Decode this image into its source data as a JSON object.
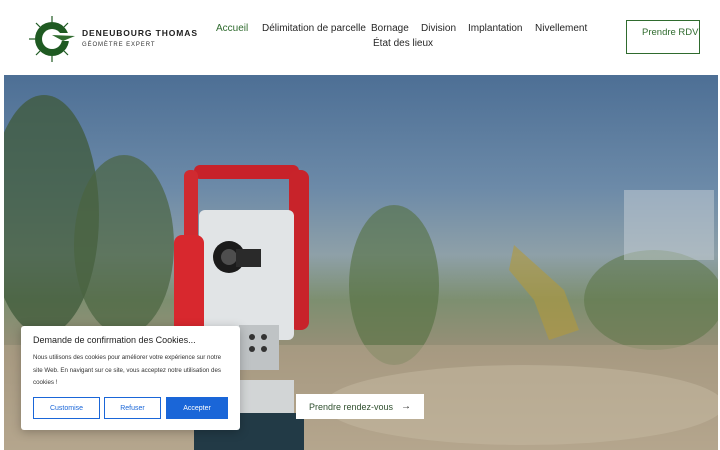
{
  "brand": {
    "name": "DENEUBOURG THOMAS",
    "subtitle": "GÉOMÈTRE EXPERT",
    "accent_color": "#2f6b2e"
  },
  "nav": {
    "items": [
      {
        "label": "Accueil",
        "active": true
      },
      {
        "label": "Délimitation de parcelle",
        "active": false
      },
      {
        "label": "Bornage",
        "active": false
      },
      {
        "label": "Division",
        "active": false
      },
      {
        "label": "Implantation",
        "active": false
      },
      {
        "label": "Nivellement",
        "active": false
      },
      {
        "label": "État des lieux",
        "active": false
      }
    ],
    "rdv_label": "Prendre RDV"
  },
  "hero": {
    "cta_label": "Prendre rendez-vous",
    "cta_icon": "arrow-right-icon"
  },
  "cookie": {
    "title": "Demande de confirmation des Cookies...",
    "text": "Nous utilisons des cookies pour améliorer votre expérience sur notre site Web. En navigant sur ce site, vous acceptez notre utilisation des cookies !",
    "customize_label": "Customise",
    "refuse_label": "Refuser",
    "accept_label": "Accepter",
    "button_color": "#1a66d8"
  }
}
